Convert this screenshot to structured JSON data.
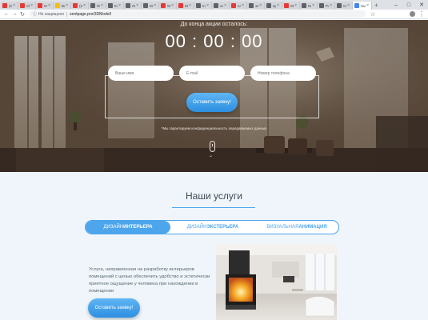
{
  "browser": {
    "tabs": [
      {
        "title": "(235) I",
        "color": "#e53935"
      },
      {
        "title": "Ch",
        "color": "#e53935"
      },
      {
        "title": "57 - Al",
        "color": "#e53935"
      },
      {
        "title": "Все ку",
        "color": "#fbbc05"
      },
      {
        "title": "(224) \\",
        "color": "#e53935"
      },
      {
        "title": "Пингу",
        "color": "#5f6368"
      },
      {
        "title": "Комп",
        "color": "#5f6368"
      },
      {
        "title": "Лендо",
        "color": "#5f6368"
      },
      {
        "title": "Метод",
        "color": "#5f6368"
      },
      {
        "title": "08 - Ро",
        "color": "#e53935"
      },
      {
        "title": "08 - Ро",
        "color": "#e53935"
      },
      {
        "title": "Ino 09",
        "color": "#5f6368"
      },
      {
        "title": "онлайн",
        "color": "#5f6368"
      },
      {
        "title": "плей ·",
        "color": "#e53935"
      },
      {
        "title": "запуск",
        "color": "#5f6368"
      },
      {
        "title": "куда",
        "color": "#5f6368"
      },
      {
        "title": "09 - 3а",
        "color": "#e53935"
      },
      {
        "title": "Need",
        "color": "#5f6368"
      },
      {
        "title": "Portfo",
        "color": "#5f6368"
      },
      {
        "title": "Секун",
        "color": "#5f6368"
      },
      {
        "title": "Sun",
        "color": "#4285f4"
      }
    ],
    "address": {
      "insecure_label": "Не защищено",
      "url": "sentpage.pro/3DModel/"
    }
  },
  "hero": {
    "countdown_label": "До конца акции осталось:",
    "countdown": "00 : 00 : 00",
    "form": {
      "name_placeholder": "Ваше имя",
      "email_placeholder": "E-mail",
      "phone_placeholder": "Номер телефона",
      "submit_label": "Оставить заявку!"
    },
    "privacy_note": "*Мы гарантируем конфиденциальность передаваемых данных"
  },
  "services": {
    "heading": "Наши услуги",
    "tabs": [
      {
        "prefix": "ДИЗАЙН ",
        "bold": "ИНТЕРЬЕРА",
        "active": true
      },
      {
        "prefix": "ДИЗАЙН ",
        "bold": "ЭКСТЕРЬЕРА",
        "active": false
      },
      {
        "prefix": "ВИЗУАЛЬНАЯ ",
        "bold": "АНИМАЦИЯ",
        "active": false
      }
    ],
    "description": "Услуга, направленная на разработку интерьеров помещений с целью обеспечить удобство и эстетически приятное ощущение у человека при нахождении в помещении",
    "cta_label": "Оставить заявку!"
  },
  "colors": {
    "accent": "#4da5ec",
    "button_top": "#5fb6f4",
    "button_bottom": "#2d8fe0",
    "section_bg": "#eff5fa"
  }
}
